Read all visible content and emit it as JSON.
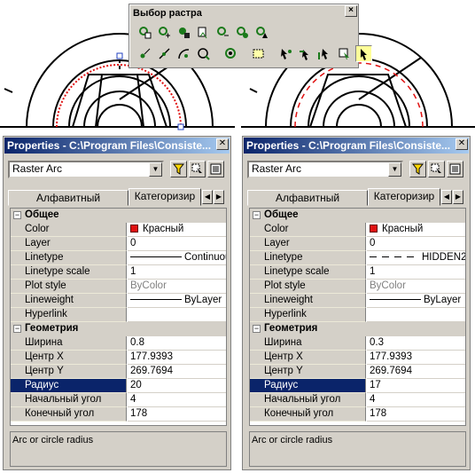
{
  "toolbar": {
    "title": "Выбор растра",
    "close": "×",
    "row1_icons": [
      "raster-select-icon",
      "raster-select-plus-icon",
      "raster-erase-icon",
      "raster-copy-icon",
      "raster-select-minus-icon",
      "raster-select-all-icon",
      "raster-select-region-icon"
    ],
    "row2_icons": [
      "raster-point-icon",
      "raster-line-icon",
      "raster-arc-icon",
      "raster-circle-icon",
      "raster-entity-icon",
      "raster-region-icon",
      "raster-pick-icon",
      "raster-pick-line-icon",
      "raster-pick-arc-icon",
      "raster-pick-box-icon",
      "raster-pick-active-icon"
    ]
  },
  "panels": [
    {
      "title": "Properties - C:\\Program Files\\Consiste...",
      "object_type": "Raster Arc",
      "tab_alpha": "Алфавитный",
      "tab_category": "Категоризир",
      "group_general": "Общее",
      "group_geometry": "Геометрия",
      "general": [
        {
          "name": "Color",
          "value": "Красный"
        },
        {
          "name": "Layer",
          "value": "0"
        },
        {
          "name": "Linetype",
          "value": "Continuous"
        },
        {
          "name": "Linetype scale",
          "value": "1"
        },
        {
          "name": "Plot style",
          "value": "ByColor"
        },
        {
          "name": "Lineweight",
          "value": "ByLayer"
        },
        {
          "name": "Hyperlink",
          "value": ""
        }
      ],
      "geometry": [
        {
          "name": "Ширина",
          "value": "0.8"
        },
        {
          "name": "Центр X",
          "value": "177.9393"
        },
        {
          "name": "Центр Y",
          "value": "269.7694"
        },
        {
          "name": "Радиус",
          "value": "20"
        },
        {
          "name": "Начальный угол",
          "value": "4"
        },
        {
          "name": "Конечный угол",
          "value": "178"
        }
      ],
      "description": "Arc or circle radius"
    },
    {
      "title": "Properties - C:\\Program Files\\Consiste...",
      "object_type": "Raster Arc",
      "tab_alpha": "Алфавитный",
      "tab_category": "Категоризир",
      "group_general": "Общее",
      "group_geometry": "Геометрия",
      "general": [
        {
          "name": "Color",
          "value": "Красный"
        },
        {
          "name": "Layer",
          "value": "0"
        },
        {
          "name": "Linetype",
          "value": "HIDDEN2"
        },
        {
          "name": "Linetype scale",
          "value": "1"
        },
        {
          "name": "Plot style",
          "value": "ByColor"
        },
        {
          "name": "Lineweight",
          "value": "ByLayer"
        },
        {
          "name": "Hyperlink",
          "value": ""
        }
      ],
      "geometry": [
        {
          "name": "Ширина",
          "value": "0.3"
        },
        {
          "name": "Центр X",
          "value": "177.9393"
        },
        {
          "name": "Центр Y",
          "value": "269.7694"
        },
        {
          "name": "Радиус",
          "value": "17"
        },
        {
          "name": "Начальный угол",
          "value": "4"
        },
        {
          "name": "Конечный угол",
          "value": "178"
        }
      ],
      "description": "Arc or circle radius"
    }
  ],
  "colors": {
    "accent_red": "#e01010",
    "titlebar": "#0a246a",
    "selection": "#0a246a",
    "face": "#d4d0c8"
  }
}
